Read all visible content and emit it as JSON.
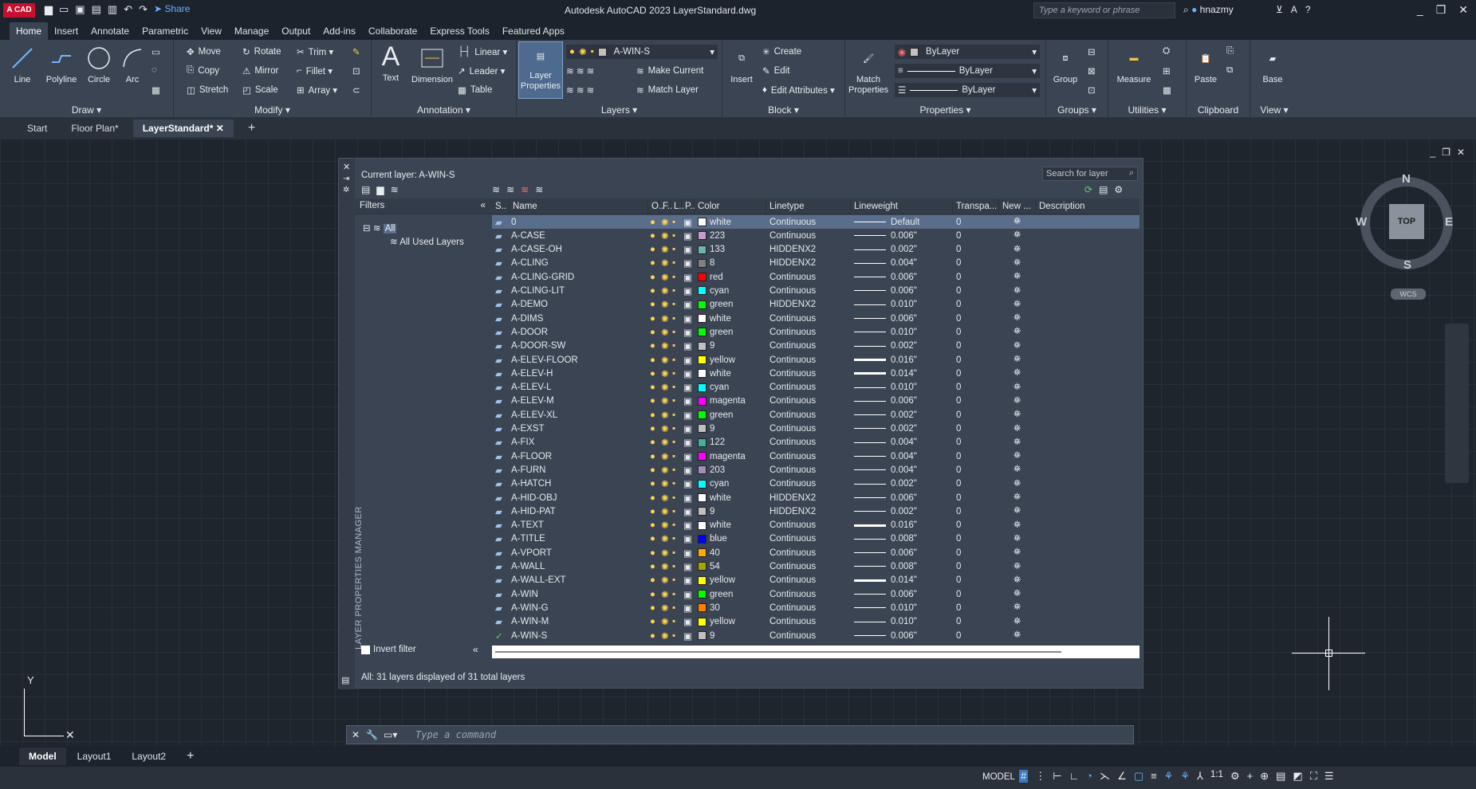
{
  "app": {
    "title": "Autodesk AutoCAD 2023   LayerStandard.dwg",
    "logo": "A CAD",
    "share": "Share",
    "search_placeholder": "Type a keyword or phrase",
    "user": "hnazmy"
  },
  "ribbon_tabs": [
    "Home",
    "Insert",
    "Annotate",
    "Parametric",
    "View",
    "Manage",
    "Output",
    "Add-ins",
    "Collaborate",
    "Express Tools",
    "Featured Apps"
  ],
  "ribbon": {
    "draw": {
      "title": "Draw ▾",
      "line": "Line",
      "polyline": "Polyline",
      "circle": "Circle",
      "arc": "Arc"
    },
    "modify": {
      "title": "Modify ▾",
      "move": "Move",
      "rotate": "Rotate",
      "trim": "Trim ▾",
      "copy": "Copy",
      "mirror": "Mirror",
      "fillet": "Fillet ▾",
      "stretch": "Stretch",
      "scale": "Scale",
      "array": "Array ▾"
    },
    "annotation": {
      "title": "Annotation ▾",
      "text": "Text",
      "dimension": "Dimension",
      "linear": "Linear ▾",
      "leader": "Leader ▾",
      "table": "Table"
    },
    "layers": {
      "title": "Layers ▾",
      "layer_properties": "Layer Properties",
      "current": "A-WIN-S",
      "make_current": "Make Current",
      "match_layer": "Match Layer"
    },
    "block": {
      "title": "Block ▾",
      "insert": "Insert",
      "create": "Create",
      "edit": "Edit",
      "edit_attributes": "Edit Attributes ▾"
    },
    "properties": {
      "title": "Properties ▾",
      "match": "Match Properties",
      "color": "ByLayer",
      "linetype": "ByLayer",
      "lineweight": "ByLayer"
    },
    "groups": {
      "title": "Groups ▾",
      "group": "Group"
    },
    "utilities": {
      "title": "Utilities ▾",
      "measure": "Measure"
    },
    "clipboard": {
      "title": "Clipboard",
      "paste": "Paste"
    },
    "view": {
      "title": "View ▾",
      "base": "Base"
    }
  },
  "doc_tabs": [
    "Start",
    "Floor Plan*",
    "LayerStandard*"
  ],
  "lpm": {
    "current_layer": "Current layer: A-WIN-S",
    "search_placeholder": "Search for layer",
    "filters_title": "Filters",
    "filter_all": "All",
    "filter_used": "All Used Layers",
    "invert_filter": "Invert filter",
    "side_title": "LAYER PROPERTIES MANAGER",
    "status": "All: 31 layers displayed of 31 total layers",
    "headers": [
      "S..",
      "Name",
      "O..",
      "F..",
      "L..",
      "P..",
      "Color",
      "Linetype",
      "Lineweight",
      "Transpa...",
      "New ...",
      "Description"
    ],
    "rows": [
      {
        "name": "0",
        "color": "white",
        "hex": "#ffffff",
        "linetype": "Continuous",
        "lineweight": "Default",
        "transp": "0",
        "thick": 1,
        "selected": true
      },
      {
        "name": "A-CASE",
        "color": "223",
        "hex": "#c89bd0",
        "linetype": "Continuous",
        "lineweight": "0.006\"",
        "transp": "0",
        "thick": 1
      },
      {
        "name": "A-CASE-OH",
        "color": "133",
        "hex": "#6fb3b0",
        "linetype": "HIDDENX2",
        "lineweight": "0.002\"",
        "transp": "0",
        "thick": 1
      },
      {
        "name": "A-CLING",
        "color": "8",
        "hex": "#808080",
        "linetype": "HIDDENX2",
        "lineweight": "0.004\"",
        "transp": "0",
        "thick": 1
      },
      {
        "name": "A-CLING-GRID",
        "color": "red",
        "hex": "#ff0000",
        "linetype": "Continuous",
        "lineweight": "0.006\"",
        "transp": "0",
        "thick": 1
      },
      {
        "name": "A-CLING-LIT",
        "color": "cyan",
        "hex": "#00ffff",
        "linetype": "Continuous",
        "lineweight": "0.006\"",
        "transp": "0",
        "thick": 1
      },
      {
        "name": "A-DEMO",
        "color": "green",
        "hex": "#00ff00",
        "linetype": "HIDDENX2",
        "lineweight": "0.010\"",
        "transp": "0",
        "thick": 1
      },
      {
        "name": "A-DIMS",
        "color": "white",
        "hex": "#ffffff",
        "linetype": "Continuous",
        "lineweight": "0.006\"",
        "transp": "0",
        "thick": 1
      },
      {
        "name": "A-DOOR",
        "color": "green",
        "hex": "#00ff00",
        "linetype": "Continuous",
        "lineweight": "0.010\"",
        "transp": "0",
        "thick": 1
      },
      {
        "name": "A-DOOR-SW",
        "color": "9",
        "hex": "#c0c0c0",
        "linetype": "Continuous",
        "lineweight": "0.002\"",
        "transp": "0",
        "thick": 1
      },
      {
        "name": "A-ELEV-FLOOR",
        "color": "yellow",
        "hex": "#ffff00",
        "linetype": "Continuous",
        "lineweight": "0.016\"",
        "transp": "0",
        "thick": 3
      },
      {
        "name": "A-ELEV-H",
        "color": "white",
        "hex": "#ffffff",
        "linetype": "Continuous",
        "lineweight": "0.014\"",
        "transp": "0",
        "thick": 3
      },
      {
        "name": "A-ELEV-L",
        "color": "cyan",
        "hex": "#00ffff",
        "linetype": "Continuous",
        "lineweight": "0.010\"",
        "transp": "0",
        "thick": 1
      },
      {
        "name": "A-ELEV-M",
        "color": "magenta",
        "hex": "#ff00ff",
        "linetype": "Continuous",
        "lineweight": "0.006\"",
        "transp": "0",
        "thick": 1
      },
      {
        "name": "A-ELEV-XL",
        "color": "green",
        "hex": "#00ff00",
        "linetype": "Continuous",
        "lineweight": "0.002\"",
        "transp": "0",
        "thick": 1
      },
      {
        "name": "A-EXST",
        "color": "9",
        "hex": "#c0c0c0",
        "linetype": "Continuous",
        "lineweight": "0.002\"",
        "transp": "0",
        "thick": 1
      },
      {
        "name": "A-FIX",
        "color": "122",
        "hex": "#3fb39b",
        "linetype": "Continuous",
        "lineweight": "0.004\"",
        "transp": "0",
        "thick": 1
      },
      {
        "name": "A-FLOOR",
        "color": "magenta",
        "hex": "#ff00ff",
        "linetype": "Continuous",
        "lineweight": "0.004\"",
        "transp": "0",
        "thick": 1
      },
      {
        "name": "A-FURN",
        "color": "203",
        "hex": "#a68bbd",
        "linetype": "Continuous",
        "lineweight": "0.004\"",
        "transp": "0",
        "thick": 1
      },
      {
        "name": "A-HATCH",
        "color": "cyan",
        "hex": "#00ffff",
        "linetype": "Continuous",
        "lineweight": "0.002\"",
        "transp": "0",
        "thick": 1
      },
      {
        "name": "A-HID-OBJ",
        "color": "white",
        "hex": "#ffffff",
        "linetype": "HIDDENX2",
        "lineweight": "0.006\"",
        "transp": "0",
        "thick": 1
      },
      {
        "name": "A-HID-PAT",
        "color": "9",
        "hex": "#c0c0c0",
        "linetype": "HIDDENX2",
        "lineweight": "0.002\"",
        "transp": "0",
        "thick": 1
      },
      {
        "name": "A-TEXT",
        "color": "white",
        "hex": "#ffffff",
        "linetype": "Continuous",
        "lineweight": "0.016\"",
        "transp": "0",
        "thick": 3
      },
      {
        "name": "A-TITLE",
        "color": "blue",
        "hex": "#0000ff",
        "linetype": "Continuous",
        "lineweight": "0.008\"",
        "transp": "0",
        "thick": 1
      },
      {
        "name": "A-VPORT",
        "color": "40",
        "hex": "#ffaa00",
        "linetype": "Continuous",
        "lineweight": "0.006\"",
        "transp": "0",
        "thick": 1
      },
      {
        "name": "A-WALL",
        "color": "54",
        "hex": "#a5a500",
        "linetype": "Continuous",
        "lineweight": "0.008\"",
        "transp": "0",
        "thick": 1
      },
      {
        "name": "A-WALL-EXT",
        "color": "yellow",
        "hex": "#ffff00",
        "linetype": "Continuous",
        "lineweight": "0.014\"",
        "transp": "0",
        "thick": 3
      },
      {
        "name": "A-WIN",
        "color": "green",
        "hex": "#00ff00",
        "linetype": "Continuous",
        "lineweight": "0.006\"",
        "transp": "0",
        "thick": 1
      },
      {
        "name": "A-WIN-G",
        "color": "30",
        "hex": "#ff7f00",
        "linetype": "Continuous",
        "lineweight": "0.010\"",
        "transp": "0",
        "thick": 1
      },
      {
        "name": "A-WIN-M",
        "color": "yellow",
        "hex": "#ffff00",
        "linetype": "Continuous",
        "lineweight": "0.010\"",
        "transp": "0",
        "thick": 1
      },
      {
        "name": "A-WIN-S",
        "color": "9",
        "hex": "#c0c0c0",
        "linetype": "Continuous",
        "lineweight": "0.006\"",
        "transp": "0",
        "thick": 1,
        "current": true
      }
    ]
  },
  "viewcube": {
    "n": "N",
    "s": "S",
    "e": "E",
    "w": "W",
    "top": "TOP",
    "wcs": "WCS"
  },
  "ucs": {
    "y": "Y"
  },
  "command": {
    "placeholder": "Type a command"
  },
  "layout_tabs": [
    "Model",
    "Layout1",
    "Layout2"
  ],
  "status": {
    "model": "MODEL",
    "scale": "1:1"
  }
}
